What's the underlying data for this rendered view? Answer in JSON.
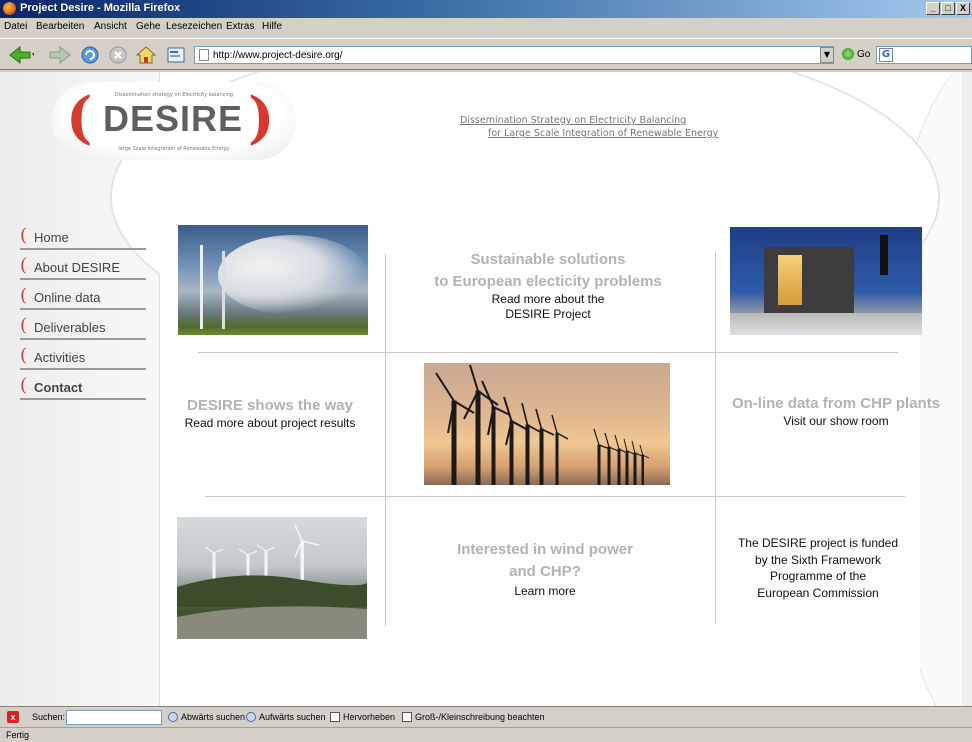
{
  "window": {
    "title": "Project Desire - Mozilla Firefox",
    "controls": [
      "_",
      "□",
      "X"
    ]
  },
  "menubar": {
    "items": [
      "Datei",
      "Bearbeiten",
      "Ansicht",
      "Gehe",
      "Lesezeichen",
      "Extras",
      "Hilfe"
    ]
  },
  "toolbar": {
    "url": "http://www.project-desire.org/",
    "go_label": "Go",
    "google_logo": "G"
  },
  "page": {
    "logo": {
      "word": "DESIRE",
      "bracket_left": "(",
      "bracket_right": ")",
      "tagline_top": "Dissemination strategy on Electricity balancing",
      "tagline_bottom": "large Scale Integration of Renewable Energy"
    },
    "heading_line1": "Dissemination Strategy on Electricity Balancing",
    "heading_line2": "for Large Scale Integration of Renewable Energy",
    "nav": [
      {
        "label": "Home"
      },
      {
        "label": "About DESIRE"
      },
      {
        "label": "Online data"
      },
      {
        "label": "Deliverables"
      },
      {
        "label": "Activities"
      },
      {
        "label": "Contact"
      }
    ],
    "nav_bracket": "(",
    "blocks": {
      "sustainable": {
        "title1": "Sustainable solutions",
        "title2": "to European electicity problems",
        "link1": "Read more about the",
        "link2": "DESIRE Project"
      },
      "way": {
        "title": "DESIRE shows the way",
        "link": "Read more about project results"
      },
      "online": {
        "title": "On-line data from CHP plants",
        "link": "Visit our show room"
      },
      "wind": {
        "title1": "Interested in wind power",
        "title2": "and CHP?",
        "link": "Learn more"
      },
      "funded": {
        "line1": "The DESIRE project is funded",
        "line2": "by the Sixth Framework",
        "line3": "Programme of the",
        "line4": "European Commission"
      }
    }
  },
  "findbar": {
    "close": "x",
    "label": "Suchen:",
    "next": "Abwärts suchen",
    "prev": "Aufwärts suchen",
    "highlight": "Hervorheben",
    "match_case": "Groß-/Kleinschreibung beachten"
  },
  "status": "Fertig",
  "colors": {
    "accent_red": "#d9392c",
    "grey_text": "#b3b3b3",
    "nav_text": "#444444"
  }
}
